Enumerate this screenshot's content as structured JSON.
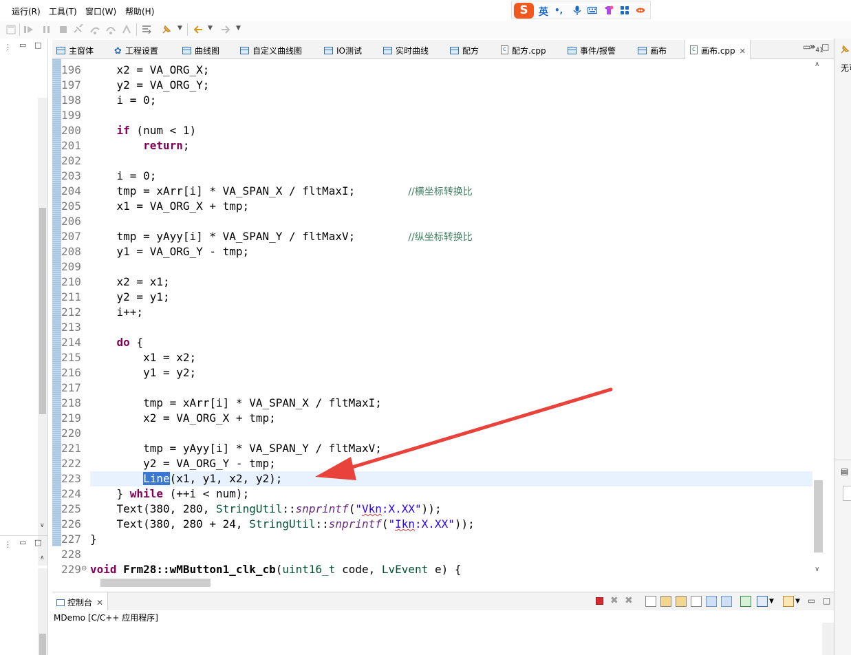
{
  "menu": {
    "items": [
      "运行(R)",
      "工具(T)",
      "窗口(W)",
      "帮助(H)"
    ]
  },
  "ime": {
    "logo": "S",
    "lang": "英",
    "extras": [
      "•,",
      "mic-icon",
      "keyboard-icon",
      "skin-icon",
      "apps-icon",
      "tool-icon"
    ]
  },
  "toolbar": {
    "icons": [
      "save-icon",
      "save-all-icon",
      "run-icon",
      "pause-icon",
      "stop-icon",
      "disconnect-icon",
      "step-into-icon",
      "step-over-icon",
      "step-return-icon",
      "drop-frame-icon",
      "use-step-filters-icon",
      "pin-icon",
      "back-icon",
      "forward-icon"
    ]
  },
  "tabs": [
    {
      "label": "主窗体",
      "icon": "window-icon"
    },
    {
      "label": "工程设置",
      "icon": "gear-icon"
    },
    {
      "label": "曲线图",
      "icon": "window-icon"
    },
    {
      "label": "自定义曲线图",
      "icon": "window-icon"
    },
    {
      "label": "IO测试",
      "icon": "window-icon"
    },
    {
      "label": "实时曲线",
      "icon": "window-icon"
    },
    {
      "label": "配方",
      "icon": "window-icon"
    },
    {
      "label": "配方.cpp",
      "icon": "c-file-icon"
    },
    {
      "label": "事件/报警",
      "icon": "window-icon"
    },
    {
      "label": "画布",
      "icon": "window-icon"
    },
    {
      "label": "画布.cpp",
      "icon": "c-file-icon",
      "active": true,
      "close": "✕"
    }
  ],
  "tab_overflow": {
    "symbol": "»",
    "count": "41"
  },
  "editor": {
    "current_line": 223,
    "lines": [
      {
        "n": "196",
        "text": "    x2 = VA_ORG_X;"
      },
      {
        "n": "197",
        "text": "    y2 = VA_ORG_Y;"
      },
      {
        "n": "198",
        "text": "    i = 0;"
      },
      {
        "n": "199",
        "text": ""
      },
      {
        "n": "200",
        "text": "    if (num < 1)"
      },
      {
        "n": "201",
        "text": "        return;"
      },
      {
        "n": "202",
        "text": ""
      },
      {
        "n": "203",
        "text": "    i = 0;"
      },
      {
        "n": "204",
        "text": "    tmp = xArr[i] * VA_SPAN_X / fltMaxI;        //横坐标转换比"
      },
      {
        "n": "205",
        "text": "    x1 = VA_ORG_X + tmp;"
      },
      {
        "n": "206",
        "text": ""
      },
      {
        "n": "207",
        "text": "    tmp = yAyy[i] * VA_SPAN_Y / fltMaxV;        //纵坐标转换比"
      },
      {
        "n": "208",
        "text": "    y1 = VA_ORG_Y - tmp;"
      },
      {
        "n": "209",
        "text": ""
      },
      {
        "n": "210",
        "text": "    x2 = x1;"
      },
      {
        "n": "211",
        "text": "    y2 = y1;"
      },
      {
        "n": "212",
        "text": "    i++;"
      },
      {
        "n": "213",
        "text": ""
      },
      {
        "n": "214",
        "text": "    do {"
      },
      {
        "n": "215",
        "text": "        x1 = x2;"
      },
      {
        "n": "216",
        "text": "        y1 = y2;"
      },
      {
        "n": "217",
        "text": ""
      },
      {
        "n": "218",
        "text": "        tmp = xArr[i] * VA_SPAN_X / fltMaxI;"
      },
      {
        "n": "219",
        "text": "        x2 = VA_ORG_X + tmp;"
      },
      {
        "n": "220",
        "text": ""
      },
      {
        "n": "221",
        "text": "        tmp = yAyy[i] * VA_SPAN_Y / fltMaxV;"
      },
      {
        "n": "222",
        "text": "        y2 = VA_ORG_Y - tmp;"
      },
      {
        "n": "223",
        "text": "        Line(x1, y1, x2, y2);"
      },
      {
        "n": "224",
        "text": "    } while (++i < num);"
      },
      {
        "n": "225",
        "text": "    Text(380, 280, StringUtil::snprintf(\"Vkn:X.XX\"));"
      },
      {
        "n": "226",
        "text": "    Text(380, 280 + 24, StringUtil::snprintf(\"Ikn:X.XX\"));"
      },
      {
        "n": "227",
        "text": "}"
      },
      {
        "n": "228",
        "text": ""
      },
      {
        "n": "229",
        "text": "void Frm28::wMButton1_clk_cb(uint16_t code, LvEvent e) {"
      }
    ]
  },
  "right_panel": {
    "text": "无可"
  },
  "console": {
    "tab_label": "控制台",
    "tab_close": "✕",
    "description": "MDemo [C/C++ 应用程序]",
    "tool_icons": [
      "terminate-icon",
      "remove-launch-icon",
      "remove-all-icon",
      "clear-console-icon",
      "scroll-lock-icon",
      "word-wrap-icon",
      "show-on-stdout-icon",
      "show-on-stderr-icon",
      "pin-console-icon",
      "display-console-icon",
      "open-console-icon",
      "minimize-icon",
      "maximize-icon"
    ]
  },
  "colors": {
    "keyword": "#7f0055",
    "comment": "#3f7f5f",
    "string": "#2a00ff",
    "type": "#005032",
    "selection": "#3a78d3",
    "current_line": "#e8f2fe",
    "arrow": "#e8423a"
  }
}
